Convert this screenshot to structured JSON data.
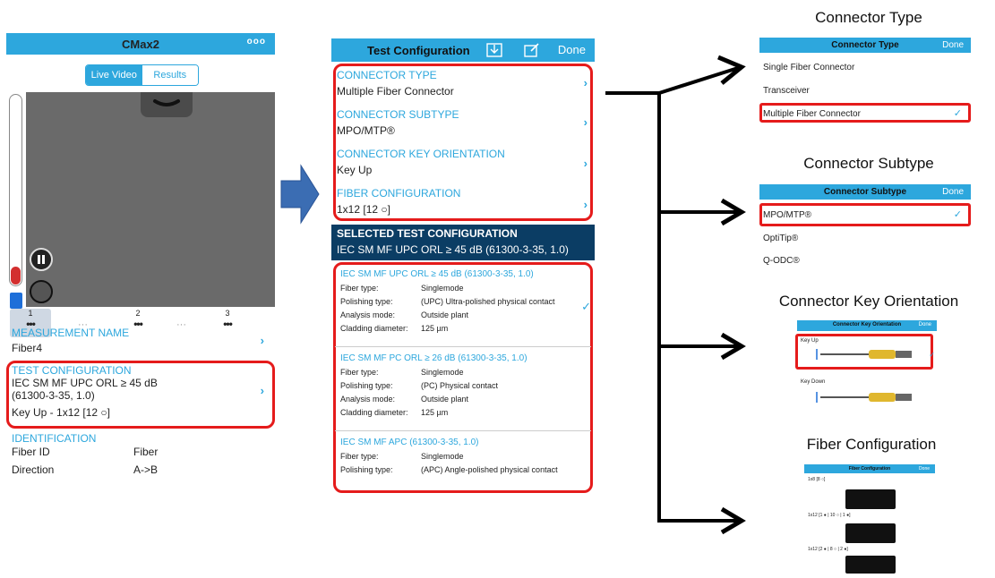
{
  "phone1": {
    "title": "CMax2",
    "menu_dots": "ooo",
    "seg_live": "Live Video",
    "seg_results": "Results",
    "steps": [
      {
        "num": "1",
        "icon": "•••"
      },
      {
        "num": "2",
        "icon": "•••"
      },
      {
        "num": "3",
        "icon": "•••"
      }
    ],
    "step_dots": "···",
    "measurement_label": "MEASUREMENT NAME",
    "measurement_value": "Fiber4",
    "testcfg_label": "TEST CONFIGURATION",
    "testcfg_value_1": "IEC SM MF UPC ORL ≥ 45 dB",
    "testcfg_value_2": "(61300-3-35, 1.0)",
    "testcfg_value_3": "Key Up - 1x12 [12 ○]",
    "ident_label": "IDENTIFICATION",
    "fiber_id_label": "Fiber ID",
    "fiber_id_value": "Fiber",
    "direction_label": "Direction",
    "direction_value": "A->B"
  },
  "panel2": {
    "title": "Test Configuration",
    "done": "Done",
    "connector_type_label": "CONNECTOR TYPE",
    "connector_type_value": "Multiple Fiber Connector",
    "connector_subtype_label": "CONNECTOR SUBTYPE",
    "connector_subtype_value": "MPO/MTP®",
    "key_orientation_label": "CONNECTOR KEY ORIENTATION",
    "key_orientation_value": "Key Up",
    "fiber_config_label": "FIBER CONFIGURATION",
    "fiber_config_value": "1x12 [12 ○]",
    "selected_label": "SELECTED TEST CONFIGURATION",
    "selected_value": "IEC SM MF UPC ORL ≥ 45 dB (61300-3-35, 1.0)",
    "configs": [
      {
        "title": "IEC SM MF UPC ORL ≥ 45 dB (61300-3-35, 1.0)",
        "rows": [
          {
            "k": "Fiber type:",
            "v": "Singlemode"
          },
          {
            "k": "Polishing type:",
            "v": "(UPC) Ultra-polished physical contact"
          },
          {
            "k": "Analysis mode:",
            "v": "Outside plant"
          },
          {
            "k": "Cladding diameter:",
            "v": "125 µm"
          }
        ]
      },
      {
        "title": "IEC SM MF PC ORL ≥ 26 dB (61300-3-35, 1.0)",
        "rows": [
          {
            "k": "Fiber type:",
            "v": "Singlemode"
          },
          {
            "k": "Polishing type:",
            "v": "(PC) Physical contact"
          },
          {
            "k": "Analysis mode:",
            "v": "Outside plant"
          },
          {
            "k": "Cladding diameter:",
            "v": "125 µm"
          }
        ]
      },
      {
        "title": "IEC SM MF APC (61300-3-35, 1.0)",
        "rows": [
          {
            "k": "Fiber type:",
            "v": "Singlemode"
          },
          {
            "k": "Polishing type:",
            "v": "(APC) Angle-polished physical contact"
          }
        ]
      }
    ]
  },
  "ct_panel": {
    "caption": "Connector Type",
    "title": "Connector Type",
    "done": "Done",
    "items": [
      "Single Fiber Connector",
      "Transceiver",
      "Multiple Fiber Connector"
    ]
  },
  "cs_panel": {
    "caption": "Connector Subtype",
    "title": "Connector Subtype",
    "done": "Done",
    "items": [
      "MPO/MTP®",
      "OptiTip®",
      "Q-ODC®"
    ]
  },
  "ko_panel": {
    "caption": "Connector Key Orientation",
    "title": "Connector Key Orientation",
    "done": "Done",
    "items": [
      "Key Up",
      "Key Down"
    ]
  },
  "fc_panel": {
    "caption": "Fiber Configuration",
    "title": "Fiber Configuration",
    "done": "Done",
    "items": [
      "1x8 [8 ○]",
      "1x12 [1 ● | 10 ○ | 1 ●]",
      "1x12 [2 ● | 8 ○ | 2 ●]"
    ]
  },
  "colors": {
    "accent": "#2da7dd",
    "highlight": "#e51b1b",
    "selected_bar": "#0b3d64",
    "arrow": "#000000",
    "big_arrow": "#3b6db3"
  }
}
